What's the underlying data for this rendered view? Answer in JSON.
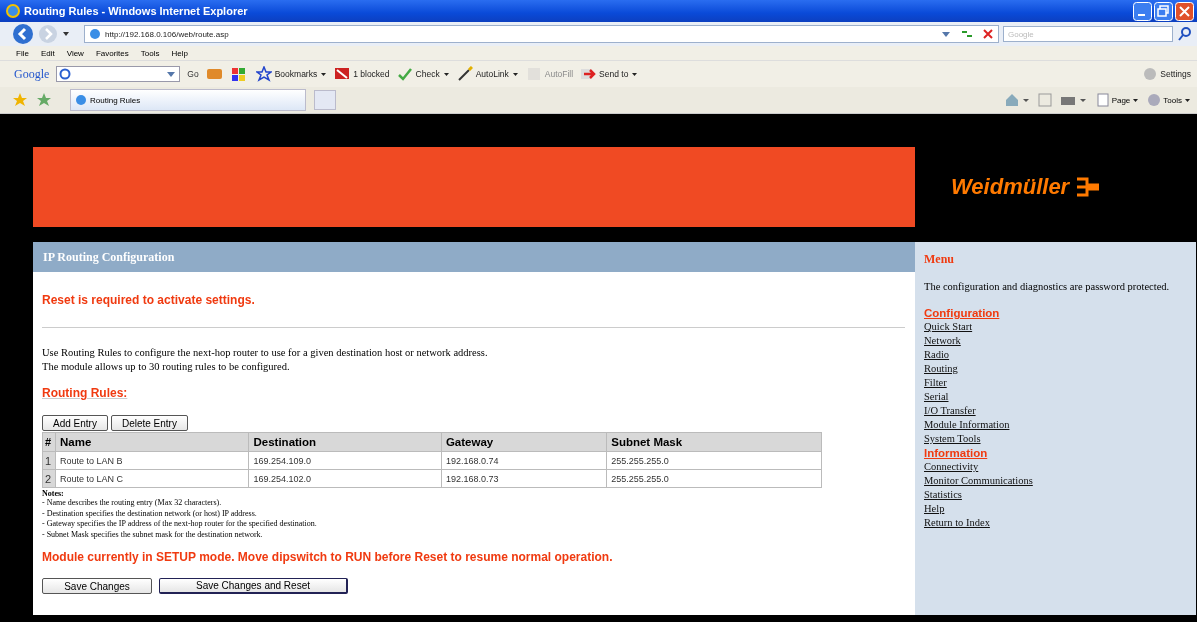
{
  "window": {
    "title": "Routing Rules - Windows Internet Explorer"
  },
  "address_bar": {
    "url": "http://192.168.0.106/web/route.asp",
    "search_placeholder": "Google"
  },
  "menu_bar": [
    "File",
    "Edit",
    "View",
    "Favorites",
    "Tools",
    "Help"
  ],
  "google_toolbar": {
    "logo": "Google",
    "go": "Go",
    "items": [
      {
        "label": "Bookmarks",
        "disabled": false,
        "dropdown": true
      },
      {
        "label": "1 blocked",
        "disabled": false,
        "dropdown": false
      },
      {
        "label": "Check",
        "disabled": false,
        "dropdown": true
      },
      {
        "label": "AutoLink",
        "disabled": false,
        "dropdown": true
      },
      {
        "label": "AutoFill",
        "disabled": true,
        "dropdown": false
      },
      {
        "label": "Send to",
        "disabled": false,
        "dropdown": true
      }
    ],
    "settings": "Settings"
  },
  "tabs": [
    {
      "label": "Routing Rules",
      "selected": true
    }
  ],
  "command_bar": [
    "Page",
    "Tools"
  ],
  "banner": {
    "logo": "Weidmüller"
  },
  "panel": {
    "title": "IP Routing Configuration",
    "alert": "Reset is required to activate settings.",
    "description": [
      "Use Routing Rules to configure the next-hop router to use for a given destination host or network address.",
      "The module allows up to 30 routing rules to be configured."
    ],
    "section_heading": "Routing Rules:",
    "table_buttons": [
      "Add Entry",
      "Delete Entry"
    ],
    "table": {
      "columns": [
        "#",
        "Name",
        "Destination",
        "Gateway",
        "Subnet Mask"
      ],
      "rows": [
        [
          "1",
          "Route to LAN B",
          "169.254.109.0",
          "192.168.0.74",
          "255.255.255.0"
        ],
        [
          "2",
          "Route to LAN C",
          "169.254.102.0",
          "192.168.0.73",
          "255.255.255.0"
        ]
      ]
    },
    "notes_title": "Notes:",
    "notes": [
      "- Name describes the routing entry (Max 32 characters).",
      "- Destination specifies the destination network (or host) IP address.",
      "- Gateway specifies the IP address of the next-hop router for the specified destination.",
      "- Subnet Mask specifies the subnet mask for the destination network."
    ],
    "warning": "Module currently in SETUP mode. Move dipswitch to RUN before Reset to resume normal operation.",
    "buttons": [
      "Save Changes",
      "Save Changes and Reset"
    ]
  },
  "sidebar": {
    "title": "Menu",
    "text": "The configuration and diagnostics are password protected.",
    "groups": [
      {
        "heading": "Configuration",
        "links": [
          "Quick Start",
          "Network",
          "Radio",
          "Routing",
          "Filter",
          "Serial",
          "I/O Transfer",
          "Module Information",
          "System Tools"
        ]
      },
      {
        "heading": "Information",
        "links": [
          "Connectivity",
          "Monitor Communications",
          "Statistics",
          "Help",
          "Return to Index"
        ]
      }
    ]
  }
}
